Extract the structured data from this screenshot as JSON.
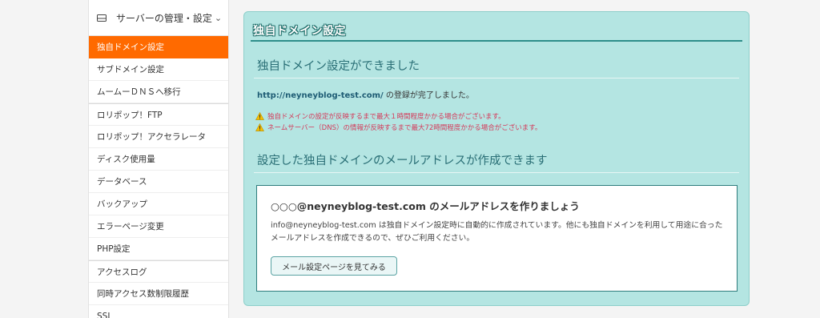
{
  "sidebar": {
    "section_title": "サーバーの管理・設定",
    "items": [
      {
        "label": "独自ドメイン設定"
      },
      {
        "label": "サブドメイン設定"
      },
      {
        "label": "ムームーＤＮＳへ移行"
      },
      {
        "label": "ロリポップ！FTP"
      },
      {
        "label": "ロリポップ！アクセラレータ"
      },
      {
        "label": "ディスク使用量"
      },
      {
        "label": "データベース"
      },
      {
        "label": "バックアップ"
      },
      {
        "label": "エラーページ変更"
      },
      {
        "label": "PHP設定"
      },
      {
        "label": "アクセスログ"
      },
      {
        "label": "同時アクセス数制限履歴"
      },
      {
        "label": "SSL"
      }
    ]
  },
  "main": {
    "title": "独自ドメイン設定",
    "heading1": "独自ドメイン設定ができました",
    "registered_url": "http://neyneyblog-test.com/",
    "registered_text": " の登録が完了しました。",
    "warnings": [
      "独自ドメインの設定が反映するまで最大１時間程度かかる場合がございます。",
      "ネームサーバー（DNS）の情報が反映するまで最大72時間程度かかる場合がございます。"
    ],
    "heading2": "設定した独自ドメインのメールアドレスが作成できます",
    "card": {
      "title": "○○○@neyneyblog-test.com のメールアドレスを作りましょう",
      "description": "info@neyneyblog-test.com は独自ドメイン設定時に自動的に作成されています。他にも独自ドメインを利用して用途に合ったメールアドレスを作成できるので、ぜひご利用ください。",
      "button_label": "メール設定ページを見てみる"
    }
  },
  "colors": {
    "accent": "#ff6a00",
    "panel_bg": "#b4e5e2",
    "heading": "#2a6f76",
    "warning": "#d43a5a"
  },
  "icons": {
    "section": "server-icon",
    "warning": "warning-triangle-icon"
  }
}
